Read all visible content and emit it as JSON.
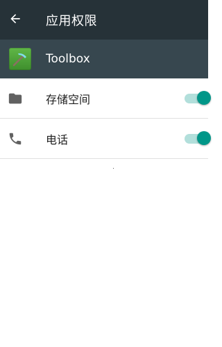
{
  "appbar": {
    "back_icon": "arrow-back-icon",
    "title": "应用权限",
    "background": "#263238"
  },
  "app": {
    "icon": "toolbox-pickaxe-icon",
    "name": "Toolbox",
    "background": "#37474F"
  },
  "permissions": [
    {
      "icon": "folder-icon",
      "label": "存储空间",
      "enabled": true
    },
    {
      "icon": "phone-icon",
      "label": "电话",
      "enabled": true
    }
  ],
  "colors": {
    "accent": "#009688",
    "switch_track": "#B2DFDB",
    "icon_grey": "#616161"
  }
}
